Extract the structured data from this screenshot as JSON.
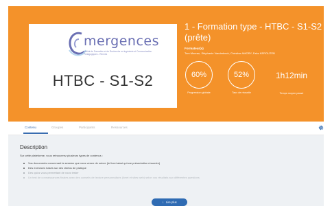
{
  "banner": {
    "color": "#f4922a",
    "logo_name": "mergences",
    "logo_subtitle": "Institut de Formation et de Recherche en Ingénierie et Communication Pédagogiques - Rennes",
    "course_code": "HTBC - S1-S2",
    "course_title": "1 - Formation type - HTBC - S1-S2 (prête)",
    "trainers_label": "Formateur(s)",
    "trainers_names": "Tom Moreau, Stéphanie Vanderbeck, Christine AMORY, Fabz KEROUTEB",
    "stats": {
      "global_progress_value": "60%",
      "global_progress_label": "Progression globale",
      "success_rate_value": "52%",
      "success_rate_label": "Taux de réussite",
      "time_value": "1h12min",
      "time_label": "Temps moyen passé"
    }
  },
  "tabs": [
    {
      "label": "Contenu",
      "active": true
    },
    {
      "label": "Groupes",
      "active": false
    },
    {
      "label": "Participants",
      "active": false
    },
    {
      "label": "Ressources",
      "active": false
    }
  ],
  "icons": {
    "settings": "gear-icon",
    "read_more": "arrow-down-icon"
  },
  "accent_color": "#2f6bb3",
  "description": {
    "title": "Description",
    "intro": "Sur cette plateforme, vous retrouverez plusieurs types de contenus :",
    "bullets": [
      "Vos documents concernant la session que vous venez de suivre (le livret ainsi qu'une présentation résumée)",
      "Des exercices basés sur des vidéos de pratique",
      "Des quizz vous permettant de vous tester",
      "Un test de connaissances finales avec des conseils de lecture personnalisés (livret et sites web) selon vos résultats aux différentes questions"
    ]
  },
  "read_more_label": "Lire plus"
}
